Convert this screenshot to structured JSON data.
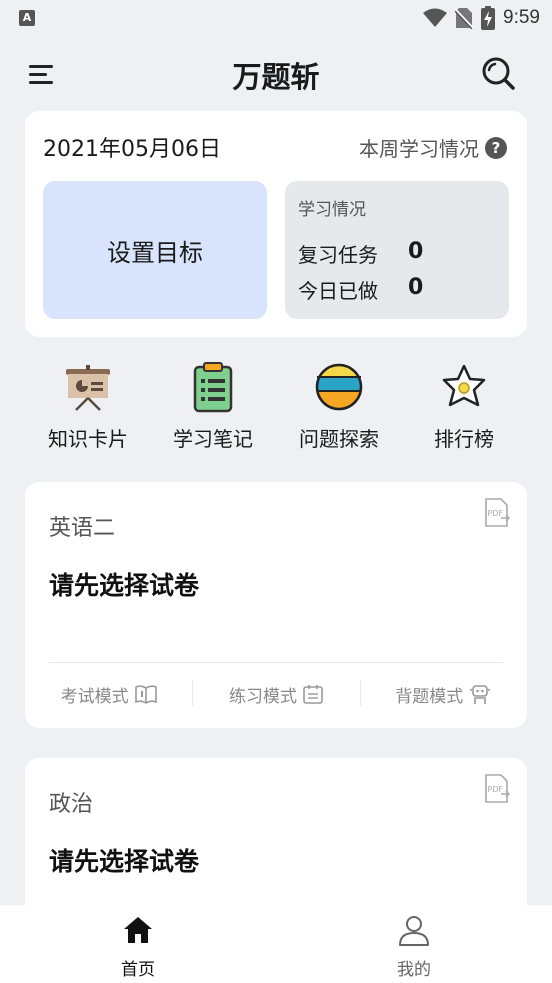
{
  "status_bar": {
    "time": "9:59",
    "left_badge": "A"
  },
  "header": {
    "title": "万题斩",
    "menu_icon": "menu-icon",
    "search_icon": "search-icon"
  },
  "stats": {
    "date": "2021年05月06日",
    "weekly_label": "本周学习情况",
    "goal_label": "设置目标",
    "study_title": "学习情况",
    "review_label": "复习任务",
    "review_value": "0",
    "today_label": "今日已做",
    "today_value": "0"
  },
  "shortcuts": [
    {
      "label": "知识卡片",
      "icon": "presentation-board-icon"
    },
    {
      "label": "学习笔记",
      "icon": "clipboard-notes-icon"
    },
    {
      "label": "问题探索",
      "icon": "striped-ball-icon"
    },
    {
      "label": "排行榜",
      "icon": "star-badge-icon"
    }
  ],
  "subjects": [
    {
      "name": "英语二",
      "paper": "请先选择试卷",
      "modes": [
        "考试模式",
        "练习模式",
        "背题模式"
      ]
    },
    {
      "name": "政治",
      "paper": "请先选择试卷"
    }
  ],
  "bottom_nav": [
    {
      "label": "首页",
      "icon": "home-icon",
      "active": true
    },
    {
      "label": "我的",
      "icon": "user-icon",
      "active": false
    }
  ],
  "colors": {
    "background": "#eef0f3",
    "goal_box": "#d8e4fb",
    "study_box": "#e6e8eb",
    "star_yellow": "#f3d94a",
    "ball_blue": "#2aa3c6",
    "ball_orange": "#f5a623",
    "notes_green": "#7fcf8e"
  }
}
